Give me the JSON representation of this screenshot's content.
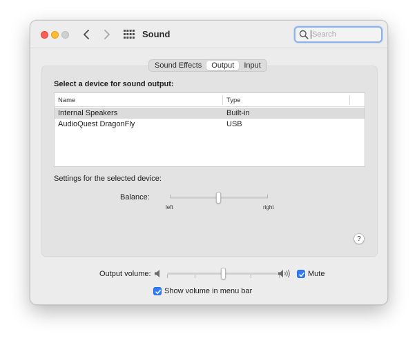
{
  "window": {
    "title": "Sound"
  },
  "search": {
    "placeholder": "Search",
    "value": ""
  },
  "tabs": [
    {
      "label": "Sound Effects",
      "active": false
    },
    {
      "label": "Output",
      "active": true
    },
    {
      "label": "Input",
      "active": false
    }
  ],
  "output": {
    "section_title": "Select a device for sound output:",
    "columns": {
      "name": "Name",
      "type": "Type"
    },
    "devices": [
      {
        "name": "Internal Speakers",
        "type": "Built-in",
        "selected": true
      },
      {
        "name": "AudioQuest DragonFly",
        "type": "USB",
        "selected": false
      }
    ],
    "settings_label": "Settings for the selected device:",
    "balance": {
      "label": "Balance:",
      "left_label": "left",
      "right_label": "right",
      "value": 0.5
    },
    "help_label": "?"
  },
  "volume": {
    "label": "Output volume:",
    "value": 0.5,
    "mute_label": "Mute",
    "mute_checked": true,
    "show_in_menu_bar_label": "Show volume in menu bar",
    "show_in_menu_bar_checked": true
  },
  "icons": {
    "back": "chevron-left-icon",
    "forward": "chevron-right-icon",
    "grid": "grid-icon",
    "search": "magnifying-glass-icon",
    "volume_low": "speaker-low-icon",
    "volume_high": "speaker-high-icon",
    "check": "checkmark-icon"
  },
  "colors": {
    "accent": "#2f7cf6",
    "close": "#fe5f57",
    "minimize": "#febc2e",
    "selection": "#dcdcdd"
  }
}
